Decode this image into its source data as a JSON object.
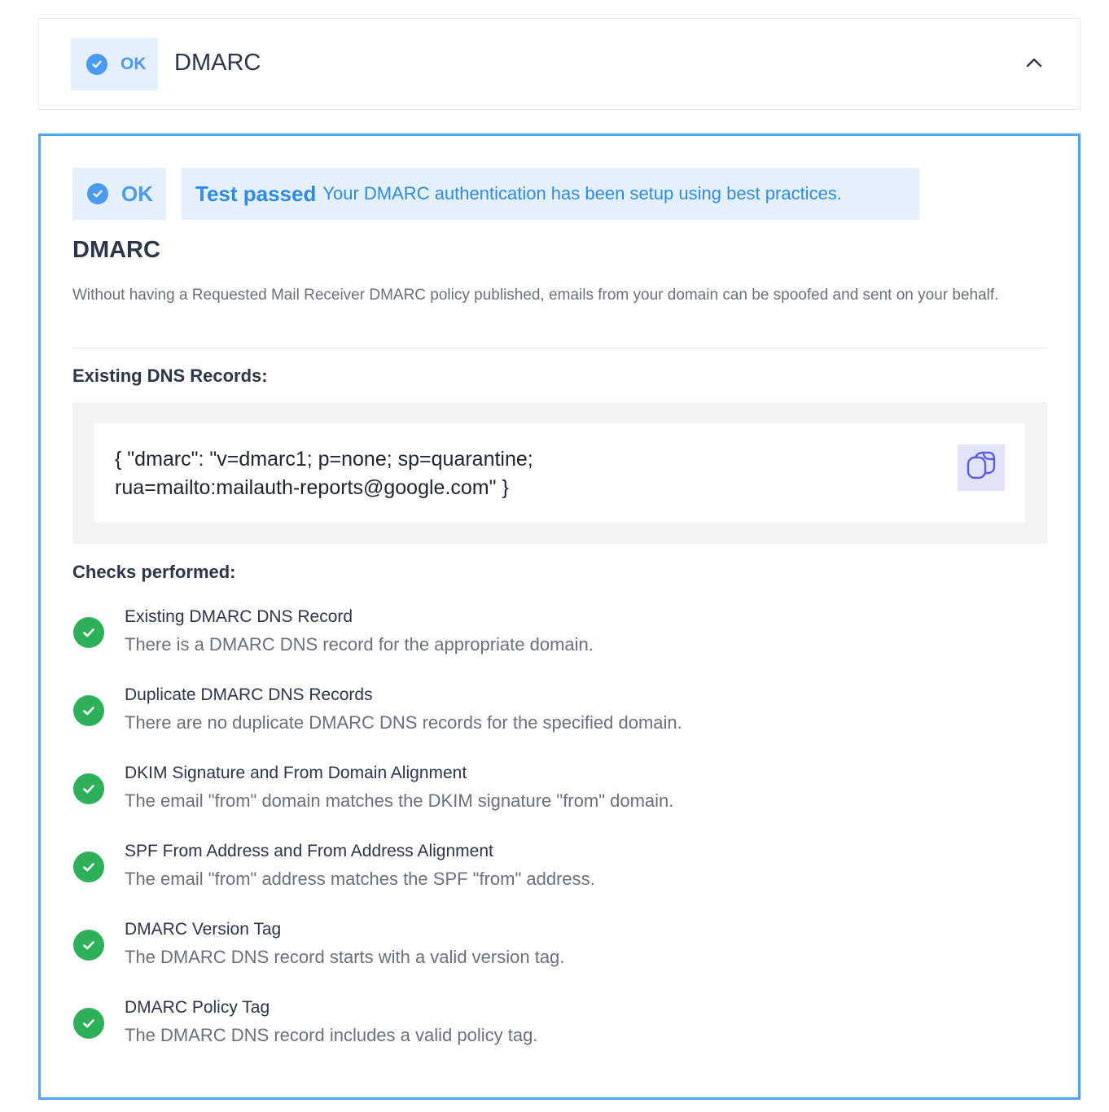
{
  "header": {
    "status": "OK",
    "title": "DMARC"
  },
  "panel": {
    "status": "OK",
    "result_label": "Test passed",
    "result_message": "Your DMARC authentication has been setup using best practices.",
    "title": "DMARC",
    "description": "Without having a Requested Mail Receiver DMARC policy published, emails from your domain can be spoofed and sent on your behalf.",
    "dns_records_label": "Existing DNS Records:",
    "dns_record_line1": "{ \"dmarc\": \"v=dmarc1; p=none; sp=quarantine;",
    "dns_record_line2": "rua=mailto:mailauth-reports@google.com\" }",
    "checks_label": "Checks performed:",
    "checks": [
      {
        "name": "Existing DMARC DNS Record",
        "description": "There is a DMARC DNS record for the appropriate domain."
      },
      {
        "name": "Duplicate DMARC DNS Records",
        "description": "There are no duplicate DMARC DNS records for the specified domain."
      },
      {
        "name": "DKIM Signature and From Domain Alignment",
        "description": "The email \"from\" domain matches the DKIM signature \"from\" domain."
      },
      {
        "name": "SPF From Address and From Address Alignment",
        "description": "The email \"from\" address matches the SPF \"from\" address."
      },
      {
        "name": "DMARC Version Tag",
        "description": "The DMARC DNS record starts with a valid version tag."
      },
      {
        "name": "DMARC Policy Tag",
        "description": "The DMARC DNS record includes a valid policy tag."
      }
    ]
  },
  "icons": {
    "status": "check-circle-icon",
    "collapse": "chevron-up-icon",
    "copy": "copy-icon",
    "check": "check-icon"
  },
  "colors": {
    "accent_blue": "#4a9bf0",
    "panel_border": "#5aa2ea",
    "pill_bg": "#e4f1fd",
    "success_green": "#2eb05a",
    "copy_bg": "#e2e3fa"
  }
}
